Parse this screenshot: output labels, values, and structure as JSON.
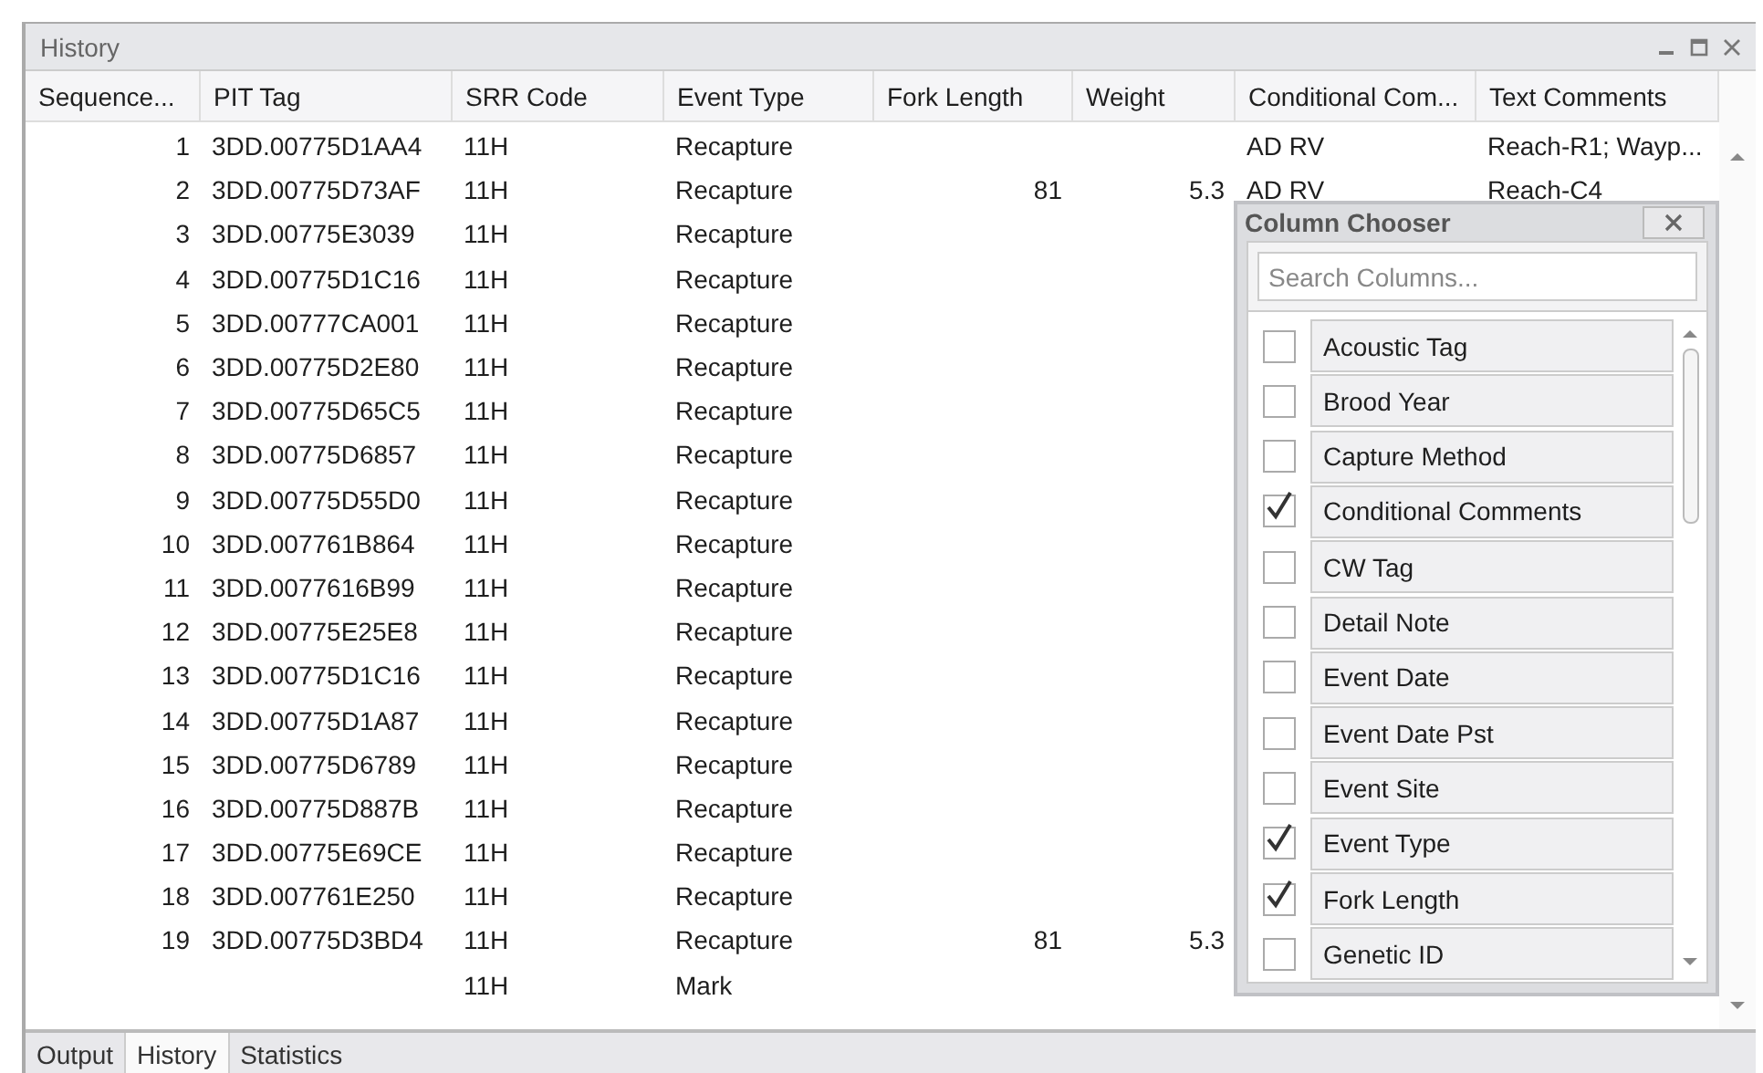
{
  "window": {
    "title": "History"
  },
  "table": {
    "columns": [
      "Sequence...",
      "PIT Tag",
      "SRR Code",
      "Event Type",
      "Fork Length",
      "Weight",
      "Conditional Com...",
      "Text Comments"
    ],
    "rows": [
      {
        "sequence": "1",
        "pit_tag": "3DD.00775D1AA4",
        "srr_code": "11H",
        "event_type": "Recapture",
        "conditional_comments": "AD RV",
        "text_comments": "Reach-R1; Wayp..."
      },
      {
        "sequence": "2",
        "pit_tag": "3DD.00775D73AF",
        "srr_code": "11H",
        "event_type": "Recapture",
        "fork_length": "81",
        "weight": "5.3",
        "conditional_comments": "AD RV",
        "text_comments": "Reach-C4"
      },
      {
        "sequence": "3",
        "pit_tag": "3DD.00775E3039",
        "srr_code": "11H",
        "event_type": "Recapture"
      },
      {
        "sequence": "4",
        "pit_tag": "3DD.00775D1C16",
        "srr_code": "11H",
        "event_type": "Recapture"
      },
      {
        "sequence": "5",
        "pit_tag": "3DD.00777CA001",
        "srr_code": "11H",
        "event_type": "Recapture"
      },
      {
        "sequence": "6",
        "pit_tag": "3DD.00775D2E80",
        "srr_code": "11H",
        "event_type": "Recapture"
      },
      {
        "sequence": "7",
        "pit_tag": "3DD.00775D65C5",
        "srr_code": "11H",
        "event_type": "Recapture"
      },
      {
        "sequence": "8",
        "pit_tag": "3DD.00775D6857",
        "srr_code": "11H",
        "event_type": "Recapture"
      },
      {
        "sequence": "9",
        "pit_tag": "3DD.00775D55D0",
        "srr_code": "11H",
        "event_type": "Recapture"
      },
      {
        "sequence": "10",
        "pit_tag": "3DD.007761B864",
        "srr_code": "11H",
        "event_type": "Recapture"
      },
      {
        "sequence": "11",
        "pit_tag": "3DD.0077616B99",
        "srr_code": "11H",
        "event_type": "Recapture"
      },
      {
        "sequence": "12",
        "pit_tag": "3DD.00775E25E8",
        "srr_code": "11H",
        "event_type": "Recapture"
      },
      {
        "sequence": "13",
        "pit_tag": "3DD.00775D1C16",
        "srr_code": "11H",
        "event_type": "Recapture"
      },
      {
        "sequence": "14",
        "pit_tag": "3DD.00775D1A87",
        "srr_code": "11H",
        "event_type": "Recapture"
      },
      {
        "sequence": "15",
        "pit_tag": "3DD.00775D6789",
        "srr_code": "11H",
        "event_type": "Recapture"
      },
      {
        "sequence": "16",
        "pit_tag": "3DD.00775D887B",
        "srr_code": "11H",
        "event_type": "Recapture"
      },
      {
        "sequence": "17",
        "pit_tag": "3DD.00775E69CE",
        "srr_code": "11H",
        "event_type": "Recapture"
      },
      {
        "sequence": "18",
        "pit_tag": "3DD.007761E250",
        "srr_code": "11H",
        "event_type": "Recapture"
      },
      {
        "sequence": "19",
        "pit_tag": "3DD.00775D3BD4",
        "srr_code": "11H",
        "event_type": "Recapture",
        "fork_length": "81",
        "weight": "5.3"
      },
      {
        "srr_code": "11H",
        "event_type": "Mark"
      }
    ]
  },
  "column_chooser": {
    "title": "Column Chooser",
    "search": {
      "placeholder": "Search Columns..."
    },
    "items": [
      {
        "label": "Acoustic Tag",
        "checked": false
      },
      {
        "label": "Brood Year",
        "checked": false
      },
      {
        "label": "Capture Method",
        "checked": false
      },
      {
        "label": "Conditional Comments",
        "checked": true
      },
      {
        "label": "CW Tag",
        "checked": false
      },
      {
        "label": "Detail Note",
        "checked": false
      },
      {
        "label": "Event Date",
        "checked": false
      },
      {
        "label": "Event Date Pst",
        "checked": false
      },
      {
        "label": "Event Site",
        "checked": false
      },
      {
        "label": "Event Type",
        "checked": true
      },
      {
        "label": "Fork Length",
        "checked": true
      },
      {
        "label": "Genetic ID",
        "checked": false
      }
    ]
  },
  "bottom_tabs": [
    {
      "label": "Output",
      "selected": false
    },
    {
      "label": "History",
      "selected": true
    },
    {
      "label": "Statistics",
      "selected": false
    }
  ]
}
